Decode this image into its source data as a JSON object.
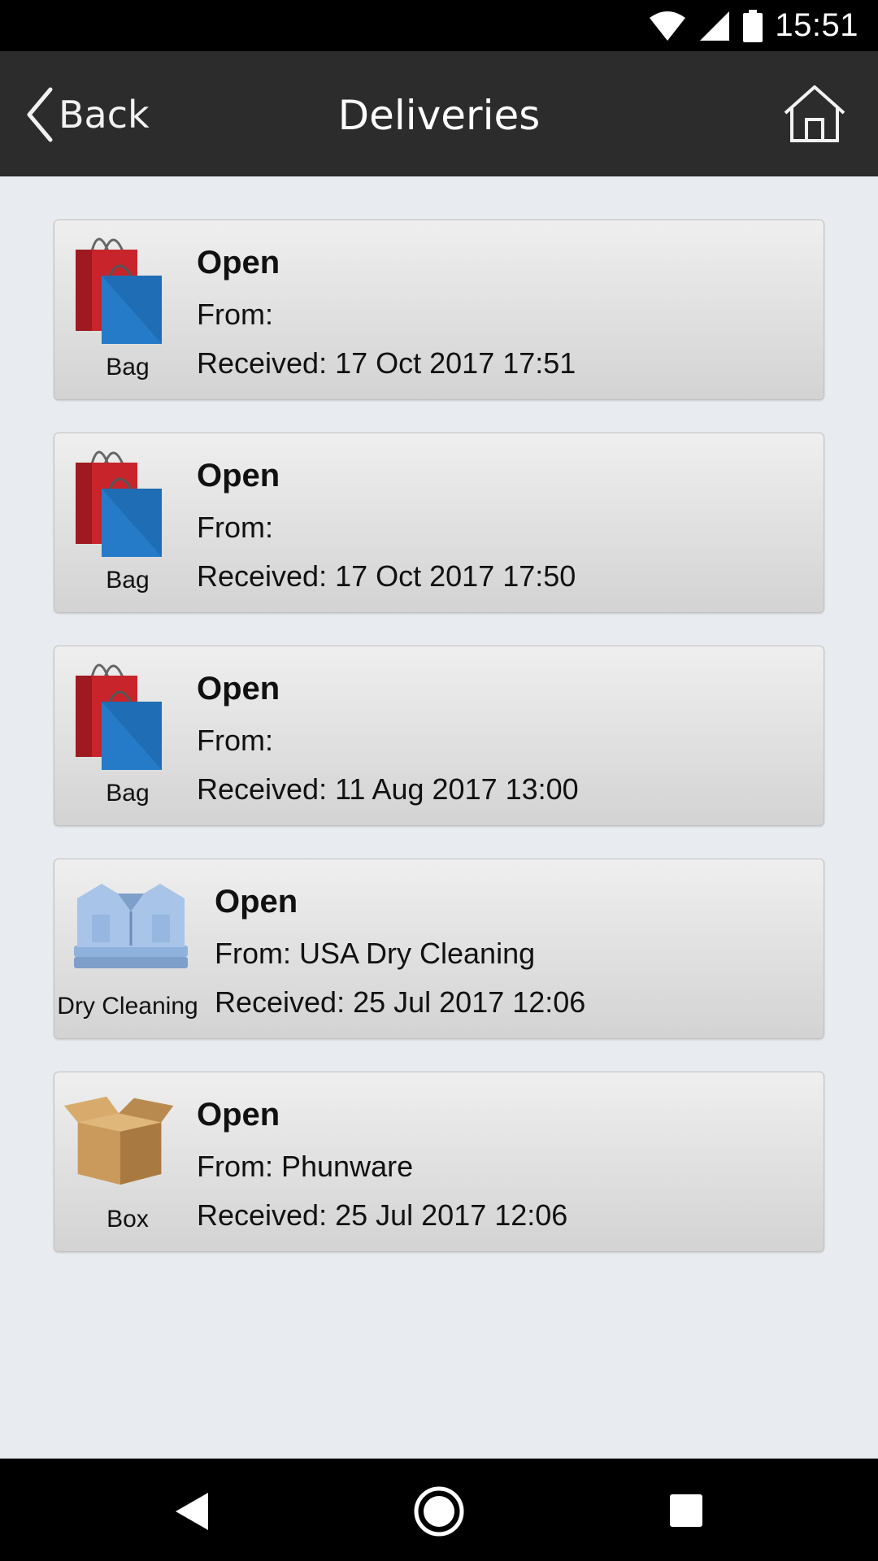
{
  "status_bar": {
    "time": "15:51"
  },
  "header": {
    "back_label": "Back",
    "title": "Deliveries"
  },
  "deliveries": [
    {
      "icon": "shopping-bags-icon",
      "icon_label": "Bag",
      "status": "Open",
      "from": "From:",
      "received": "Received: 17 Oct 2017 17:51"
    },
    {
      "icon": "shopping-bags-icon",
      "icon_label": "Bag",
      "status": "Open",
      "from": "From:",
      "received": "Received: 17 Oct 2017 17:50"
    },
    {
      "icon": "shopping-bags-icon",
      "icon_label": "Bag",
      "status": "Open",
      "from": "From:",
      "received": "Received: 11 Aug 2017 13:00"
    },
    {
      "icon": "folded-shirts-icon",
      "icon_label": "Dry Cleaning",
      "status": "Open",
      "from": "From: USA Dry Cleaning",
      "received": "Received: 25 Jul 2017 12:06"
    },
    {
      "icon": "cardboard-box-icon",
      "icon_label": "Box",
      "status": "Open",
      "from": "From: Phunware",
      "received": "Received: 25 Jul 2017 12:06"
    }
  ],
  "colors": {
    "header_bg": "#2c2c2c",
    "page_bg": "#e8ebef",
    "bag_red": "#c8242b",
    "bag_blue": "#1f6db4",
    "shirt_blue": "#8fb2dd",
    "box_tan": "#c99a5c"
  }
}
